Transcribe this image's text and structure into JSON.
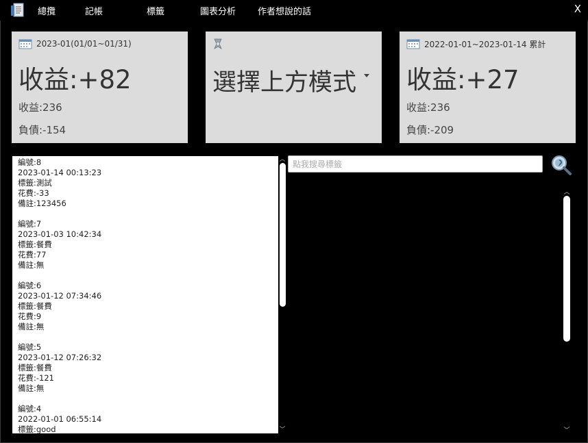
{
  "menu": {
    "items": [
      "總攬",
      "記帳",
      "標籤",
      "圖表分析",
      "作者想說的話"
    ],
    "close_label": "X"
  },
  "cards": [
    {
      "header": "2023-01(01/01~01/31)",
      "icon": "calendar-icon",
      "big": "收益:+82",
      "line1": "收益:236",
      "line2": "負債:-154"
    },
    {
      "header": "",
      "icon": "tag-icon",
      "big": "選擇上方模式"
    },
    {
      "header": "2022-01-01~2023-01-14 累計",
      "icon": "calendar-icon",
      "big": "收益:+27",
      "line1": "收益:236",
      "line2": "負債:-209"
    }
  ],
  "records": [
    [
      "編號:8",
      "2023-01-14 00:13:23",
      "標籤:測試",
      "花費:-33",
      "備註:123456"
    ],
    [
      "編號:7",
      "2023-01-03 10:42:34",
      "標籤:餐費",
      "花費:77",
      "備註:無"
    ],
    [
      "編號:6",
      "2023-01-12 07:34:46",
      "標籤:餐費",
      "花費:9",
      "備註:無"
    ],
    [
      "編號:5",
      "2023-01-12 07:26:32",
      "標籤:餐費",
      "花費:-121",
      "備註:無"
    ],
    [
      "編號:4",
      "2022-01-01 06:55:14",
      "標籤:good"
    ]
  ],
  "search": {
    "placeholder": "點我搜尋標籤",
    "value": ""
  },
  "colors": {
    "background": "#000000",
    "card": "#dcdcdc",
    "card_text": "#333333",
    "list_bg": "#ffffff"
  }
}
